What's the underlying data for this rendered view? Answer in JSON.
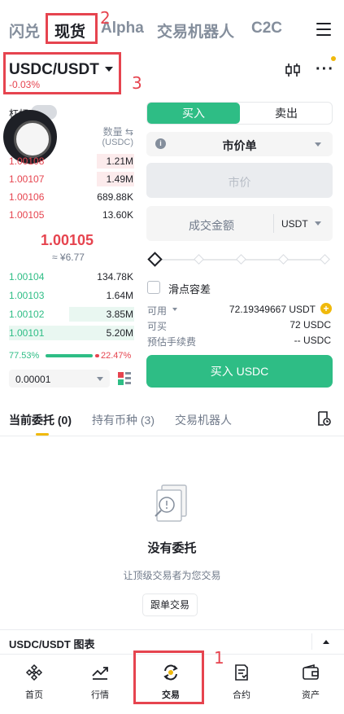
{
  "top_tabs": [
    {
      "label": "闪兑"
    },
    {
      "label": "现货"
    },
    {
      "label": "Alpha"
    },
    {
      "label": "交易机器人"
    },
    {
      "label": "C2C"
    }
  ],
  "annotations": {
    "one": "1",
    "two": "2",
    "three": "3"
  },
  "pair": {
    "symbol": "USDC/USDT",
    "change": "-0.03%"
  },
  "leverage_label": "杠杆",
  "orderbook": {
    "qty_header": "数量 ⇆",
    "unit_header": "(USDC)",
    "asks": [
      {
        "price": "1.00108",
        "qty": "1.21M",
        "depth": 0.3
      },
      {
        "price": "1.00107",
        "qty": "1.49M",
        "depth": 0.3
      },
      {
        "price": "1.00106",
        "qty": "689.88K",
        "depth": 0.0
      },
      {
        "price": "1.00105",
        "qty": "13.60K",
        "depth": 0.0
      }
    ],
    "mid_price": "1.00105",
    "mid_cny": "≈ ¥6.77",
    "bids": [
      {
        "price": "1.00104",
        "qty": "134.78K",
        "depth": 0.0
      },
      {
        "price": "1.00103",
        "qty": "1.64M",
        "depth": 0.0
      },
      {
        "price": "1.00102",
        "qty": "3.85M",
        "depth": 0.52
      },
      {
        "price": "1.00101",
        "qty": "5.20M",
        "depth": 1.0
      }
    ],
    "buy_ratio": "77.53%",
    "sell_ratio": "22.47%",
    "depth_value": "0.00001"
  },
  "trade_form": {
    "buy_tab": "买入",
    "sell_tab": "卖出",
    "order_type": "市价单",
    "price_placeholder": "市价",
    "amount_placeholder": "成交金额",
    "amount_unit": "USDT",
    "slippage_label": "滑点容差",
    "available_label": "可用",
    "available_value": "72.19349667 USDT",
    "can_buy_label": "可买",
    "can_buy_value": "72 USDC",
    "fee_label": "预估手续费",
    "fee_value": "-- USDC",
    "submit_label": "买入 USDC"
  },
  "order_tabs": [
    {
      "label": "当前委托 (0)"
    },
    {
      "label": "持有币种 (3)"
    },
    {
      "label": "交易机器人"
    }
  ],
  "empty_state": {
    "title": "没有委托",
    "subtitle": "让顶级交易者为您交易",
    "button": "跟单交易"
  },
  "chart_bar": {
    "label": "USDC/USDT 图表"
  },
  "bottom_nav": [
    {
      "label": "首页",
      "icon": "home-diamond-icon"
    },
    {
      "label": "行情",
      "icon": "market-chart-icon"
    },
    {
      "label": "交易",
      "icon": "trade-swap-icon"
    },
    {
      "label": "合约",
      "icon": "futures-contract-icon"
    },
    {
      "label": "资产",
      "icon": "wallet-icon"
    }
  ],
  "colors": {
    "up": "#2ebd85",
    "down": "#e6444f",
    "brand": "#f0b90b",
    "annotation": "#e6444f"
  }
}
